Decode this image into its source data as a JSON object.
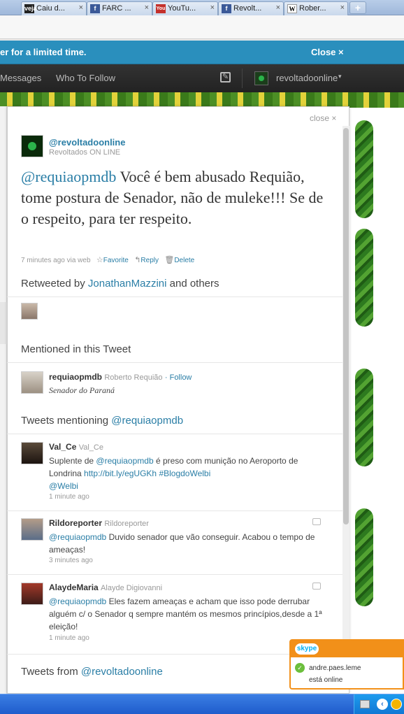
{
  "browser": {
    "tabs": [
      {
        "favicon": "veja-favicon",
        "favicon_text": "veja",
        "title": "Caiu d..."
      },
      {
        "favicon": "facebook-favicon",
        "favicon_text": "f",
        "title": "FARC ..."
      },
      {
        "favicon": "youtube-favicon",
        "favicon_text": "You",
        "title": "YouTu..."
      },
      {
        "favicon": "facebook-favicon",
        "favicon_text": "f",
        "title": "Revolt..."
      },
      {
        "favicon": "wikipedia-favicon",
        "favicon_text": "W",
        "title": "Rober..."
      }
    ],
    "close_glyph": "×",
    "new_tab_glyph": "+"
  },
  "promo": {
    "message": "er for a limited time.",
    "close_label": "Close ×"
  },
  "topbar": {
    "messages": "Messages",
    "who_to_follow": "Who To Follow",
    "compose_icon": "compose-icon",
    "username": "revoltadoonline",
    "caret": "▾"
  },
  "panel": {
    "close_label": "close ×",
    "author": {
      "handle": "@revoltadoonline",
      "name": "Revoltados ON LINE"
    },
    "tweet": {
      "mention": "@requiaopmdb",
      "text": " Você é bem abusado Requião, tome postura de Senador, não de muleke!!! Se de o respeito, para ter respeito."
    },
    "meta": {
      "time": "7 minutes ago",
      "via": "via web",
      "favorite": "Favorite",
      "reply": "Reply",
      "delete": "Delete"
    },
    "retweeted": {
      "prefix": "Retweeted by ",
      "user": "JonathanMazzini",
      "suffix": " and others"
    },
    "mentioned": {
      "title": "Mentioned in this Tweet",
      "user": "requiaopmdb",
      "name": "Roberto Requião",
      "follow": "· Follow",
      "bio": "Senador do Paraná"
    },
    "mentioning": {
      "title_prefix": "Tweets mentioning ",
      "title_link": "@requiaopmdb",
      "tweets": [
        {
          "user": "Val_Ce",
          "name": "Val_Ce",
          "pre": "Suplente de ",
          "mention": "@requiaopmdb",
          "mid": " é preso com munição no Aeroporto de Londrina ",
          "url": "http://bit.ly/egUGKh",
          "hashtag": " #BlogdoWelbi",
          "tail_mention": "@Welbi",
          "time": "1 minute ago"
        },
        {
          "user": "Rildoreporter",
          "name": "Rildoreporter",
          "mention": "@requiaopmdb",
          "text": " Duvido senador que vão conseguir. Acabou o tempo de ameaças!",
          "time": "3 minutes ago"
        },
        {
          "user": "AlaydeMaria",
          "name": "Alayde Digiovanni",
          "mention": "@requiaopmdb",
          "text": " Eles fazem ameaças e acham que isso pode derrubar alguém c/ o Senador q sempre mantém os mesmos princípios,desde a 1ª eleição!",
          "time": "1 minute ago"
        }
      ]
    },
    "tweets_from": {
      "prefix": "Tweets from ",
      "link": "@revoltadoonline"
    }
  },
  "skype": {
    "logo": "skype",
    "contact": "andre.paes.leme",
    "status": "está online"
  },
  "colors": {
    "link": "#2a7ea6",
    "promo_bg": "#2a8fbd",
    "topbar_bg": "#2b2b2b",
    "skype_orange": "#f29019",
    "taskbar_blue": "#245edb"
  }
}
